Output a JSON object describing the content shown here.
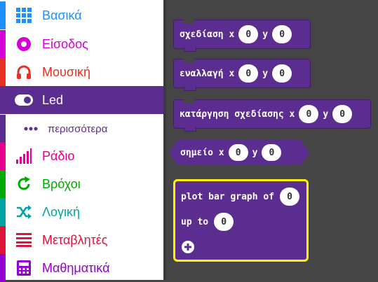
{
  "sidebar": {
    "items": [
      {
        "label": "Βασικά",
        "color": "#1E90FF",
        "icon": "grid-icon"
      },
      {
        "label": "Είσοδος",
        "color": "#D400D4",
        "icon": "radio-target-icon"
      },
      {
        "label": "Μουσική",
        "color": "#E63022",
        "icon": "headphones-icon"
      },
      {
        "label": "Led",
        "color": "#5C2D91",
        "icon": "toggle-icon",
        "selected": true
      },
      {
        "label": "περισσότερα",
        "color": "#5C2D91",
        "icon": "more-dots-icon",
        "sub": true
      },
      {
        "label": "Ράδιο",
        "color": "#E3008C",
        "icon": "signal-bars-icon"
      },
      {
        "label": "Βρόχοι",
        "color": "#00AA00",
        "icon": "refresh-icon"
      },
      {
        "label": "Λογική",
        "color": "#00A4A6",
        "icon": "shuffle-icon"
      },
      {
        "label": "Μεταβλητές",
        "color": "#DC143C",
        "icon": "list-icon"
      },
      {
        "label": "Μαθηματικά",
        "color": "#9400D3",
        "icon": "calculator-icon"
      }
    ]
  },
  "blocks": {
    "plot": {
      "text": "σχεδίαση x",
      "y_label": "y",
      "x_value": "0",
      "y_value": "0"
    },
    "toggle": {
      "text": "εναλλαγή x",
      "y_label": "y",
      "x_value": "0",
      "y_value": "0"
    },
    "unplot": {
      "text": "κατάργηση σχεδίασης x",
      "y_label": "y",
      "x_value": "0",
      "y_value": "0"
    },
    "point": {
      "text": "σημείο x",
      "y_label": "y",
      "x_value": "0",
      "y_value": "0"
    },
    "bar_graph": {
      "text": "plot bar graph of",
      "value": "0",
      "up_to_label": "up to",
      "up_to_value": "0"
    }
  },
  "colors": {
    "led_block": "#5C2D91",
    "highlight": "#FFF200",
    "workspace": "#454545"
  }
}
